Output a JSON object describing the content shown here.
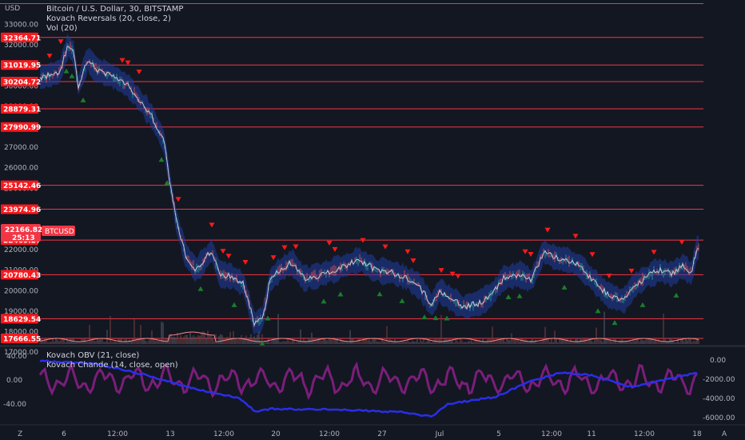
{
  "header": {
    "symbol_line": "Bitcoin / U.S. Dollar, 30, BITSTAMP",
    "indicator_1": "Kovach Reversals (20, close, 2)",
    "indicator_2": "Vol (20)"
  },
  "lower_pane": {
    "indicator_1": "Kovach OBV (21, close)",
    "indicator_2": "Kovach Chande (14, close, open)"
  },
  "price_axis": {
    "currency_label": "USD",
    "ticks": [
      "33000.00",
      "32000.00",
      "31000.00",
      "30000.00",
      "29000.00",
      "28000.00",
      "27000.00",
      "26000.00",
      "25000.00",
      "24000.00",
      "23000.00",
      "22000.00",
      "21000.00",
      "20000.00",
      "19000.00",
      "18000.00",
      "17000.00"
    ]
  },
  "level_labels": [
    "32364.71",
    "31019.95",
    "30204.72",
    "28879.31",
    "27990.99",
    "25142.46",
    "23974.96",
    "22469.27",
    "20780.43",
    "18629.54",
    "17666.55"
  ],
  "current_price": {
    "value": "22166.82",
    "countdown": "25:13",
    "ticker_tag": "BTCUSD"
  },
  "oscillator_axis": {
    "left_ticks": [
      "40.00",
      "0.00",
      "-40.00"
    ],
    "right_ticks": [
      "0.00",
      "-2000.00",
      "-4000.00",
      "-6000.00"
    ]
  },
  "time_axis": {
    "labels": [
      "6",
      "12:00",
      "13",
      "12:00",
      "20",
      "12:00",
      "27",
      "Jul",
      "5",
      "12:00",
      "11",
      "12:00",
      "18"
    ]
  },
  "corner_icons": {
    "left": "Z",
    "right": "A"
  },
  "colors": {
    "background": "#131722",
    "level_line": "#f23645",
    "level_label_bg": "#f7191d",
    "current_price_bg": "#f23645",
    "obv_line": "#2a2ee8",
    "chande_line": "#7b1e7a",
    "candle_up": "#26a69a",
    "candle_down": "#ef5350",
    "band_fill": "#1f3ea3",
    "price_line": "#c4c4d0",
    "buy_marker": "#1b7d2c",
    "sell_marker": "#ff1a1a"
  },
  "icons": {
    "buy_signal": "triangle-up-icon",
    "sell_signal": "triangle-down-icon"
  }
}
